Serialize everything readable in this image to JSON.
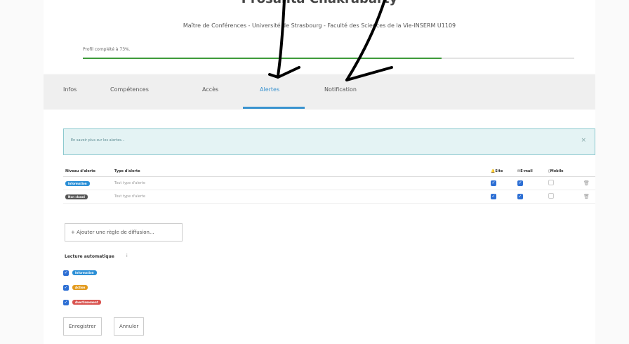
{
  "header": {
    "name": "Prosanta Chakrabarty",
    "subtitle": "Maître de Conférences - Université de Strasbourg - Faculté des Sciences de la Vie-INSERM U1109",
    "progress_label": "Profil complété à 73%.",
    "progress_fraction": 0.73
  },
  "tabs": [
    {
      "label": "Infos",
      "active": false
    },
    {
      "label": "Compétences",
      "active": false
    },
    {
      "label": "Accès",
      "active": false
    },
    {
      "label": "Alertes",
      "active": true
    },
    {
      "label": "Notification",
      "active": false
    }
  ],
  "info_box": {
    "text": "En savoir plus sur les alertes...",
    "close": "×"
  },
  "table": {
    "headers": {
      "level": "Niveau d'alerte",
      "type": "Type d'alerte",
      "site": "Site",
      "email": "E-mail",
      "mobile": "Mobile"
    },
    "rows": [
      {
        "badge": "Information",
        "badge_color": "#2b8fd6",
        "type": "Tout type d'alerte",
        "site": true,
        "email": true,
        "mobile": false
      },
      {
        "badge": "Non classé",
        "badge_color": "#555555",
        "type": "Tout type d'alerte",
        "site": true,
        "email": true,
        "mobile": false
      }
    ]
  },
  "add_rule_label": "+ Ajouter une règle de diffusion...",
  "auto_read": {
    "title": "Lecture automatique",
    "info": "i",
    "items": [
      {
        "label": "Information",
        "color": "#2b8fd6",
        "checked": true
      },
      {
        "label": "Action",
        "color": "#e39b1f",
        "checked": true
      },
      {
        "label": "Avertissement",
        "color": "#d9534f",
        "checked": true
      }
    ]
  },
  "buttons": {
    "save": "Enregistrer",
    "cancel": "Annuler"
  },
  "icons": {
    "site": "bell-icon",
    "email": "envelope-icon",
    "mobile": "mobile-icon",
    "delete": "trash-icon",
    "close": "close-icon"
  },
  "colors": {
    "accent": "#3a93cf",
    "progress": "#3e9b3a",
    "info_bg": "#e4f3f4",
    "checkbox": "#2d6fd4"
  }
}
